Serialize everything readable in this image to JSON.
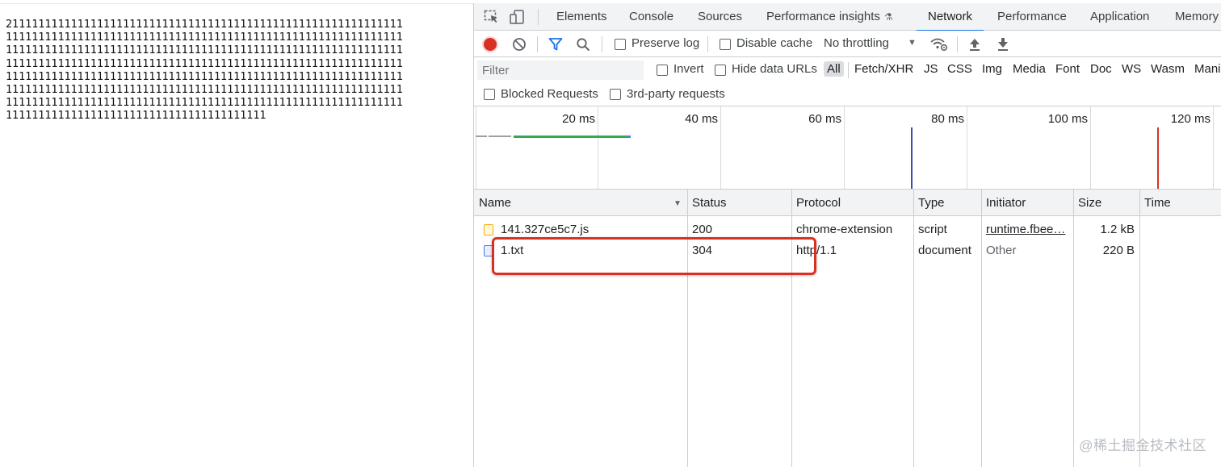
{
  "page": {
    "lines": [
      "2111111111111111111111111111111111111111111111111111111111111",
      "1111111111111111111111111111111111111111111111111111111111111",
      "1111111111111111111111111111111111111111111111111111111111111",
      "1111111111111111111111111111111111111111111111111111111111111",
      "1111111111111111111111111111111111111111111111111111111111111",
      "1111111111111111111111111111111111111111111111111111111111111",
      "1111111111111111111111111111111111111111111111111111111111111",
      "1111111111111111111111111111111111111111"
    ]
  },
  "devtools": {
    "tabs": [
      "Elements",
      "Console",
      "Sources",
      "Performance insights",
      "Network",
      "Performance",
      "Application",
      "Memory"
    ],
    "active_tab": "Network",
    "toolbar": {
      "preserve_log": "Preserve log",
      "disable_cache": "Disable cache",
      "throttling": "No throttling"
    },
    "filter": {
      "placeholder": "Filter",
      "invert": "Invert",
      "hide_data_urls": "Hide data URLs",
      "types": [
        "All",
        "Fetch/XHR",
        "JS",
        "CSS",
        "Img",
        "Media",
        "Font",
        "Doc",
        "WS",
        "Wasm",
        "Mani"
      ],
      "blocked_requests": "Blocked Requests",
      "third_party": "3rd-party requests"
    },
    "overview": {
      "ticks": [
        "20 ms",
        "40 ms",
        "60 ms",
        "80 ms",
        "100 ms",
        "120 ms"
      ]
    },
    "table": {
      "columns": [
        "Name",
        "Status",
        "Protocol",
        "Type",
        "Initiator",
        "Size",
        "Time"
      ],
      "rows": [
        {
          "name": "141.327ce5c7.js",
          "status": "200",
          "protocol": "chrome-extension",
          "type": "script",
          "initiator": "runtime.fbee…",
          "size": "1.2 kB",
          "time": "",
          "icon": "script-file-icon"
        },
        {
          "name": "1.txt",
          "status": "304",
          "protocol": "http/1.1",
          "type": "document",
          "initiator": "Other",
          "size": "220 B",
          "time": "",
          "icon": "document-file-icon"
        }
      ]
    },
    "colors": {
      "accent": "#1a73e8",
      "record_red": "#d93025",
      "highlight_box": "#d93025",
      "dom_content_loaded": "#3c4bb7",
      "load_event": "#d93025",
      "waterfall_green": "#34a853"
    }
  },
  "watermark": "@稀土掘金技术社区"
}
